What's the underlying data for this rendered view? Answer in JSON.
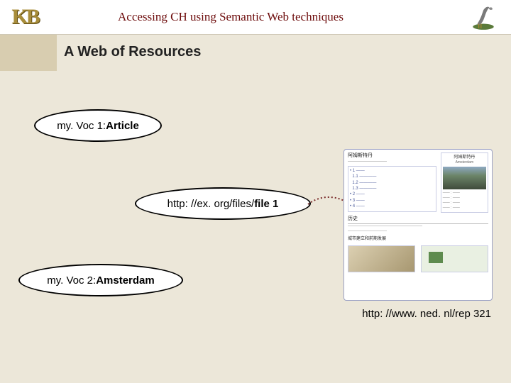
{
  "header": {
    "logo_text": "KB",
    "title": "Accessing CH using Semantic Web techniques"
  },
  "slide": {
    "title": "A Web of Resources"
  },
  "nodes": {
    "n1_prefix": "my. Voc 1: ",
    "n1_term": "Article",
    "n2_prefix": "http: //ex. org/files/",
    "n2_term": "file 1",
    "n3_prefix": "my. Voc 2: ",
    "n3_term": "Amsterdam"
  },
  "caption": "http: //www. ned. nl/rep 321",
  "wiki": {
    "heading_left": "阿姆斯特丹",
    "heading_right": "阿姆斯特丹",
    "heading_roman": "Amsterdam",
    "section": "历史",
    "bottom_caption": "城市建立和前期发展"
  }
}
